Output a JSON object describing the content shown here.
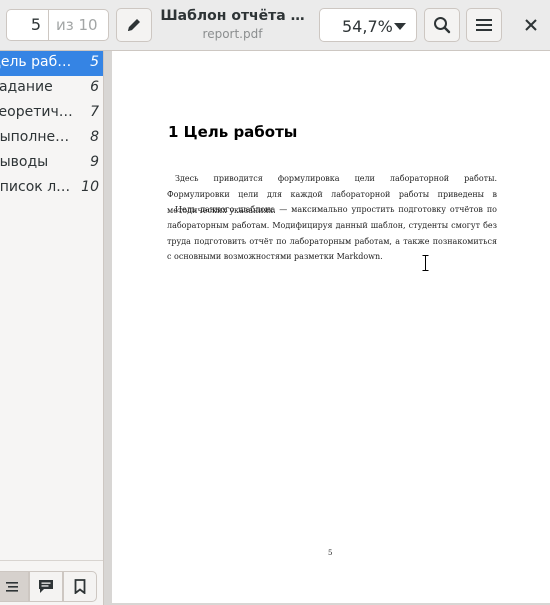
{
  "header": {
    "page_current": "5",
    "page_total": "из 10",
    "title": "Шаблон отчёта …",
    "subtitle": "report.pdf",
    "zoom": "54,7%"
  },
  "sidebar": {
    "items": [
      {
        "label": "Цель работы",
        "page": "5",
        "active": true
      },
      {
        "label": "Задание",
        "page": "6"
      },
      {
        "label": "Теоретическое введение",
        "page": "7"
      },
      {
        "label": "Выполнение лабораторной работы",
        "page": "8"
      },
      {
        "label": "Выводы",
        "page": "9"
      },
      {
        "label": "Список литературы",
        "page": "10"
      }
    ]
  },
  "document": {
    "heading": "1  Цель работы",
    "paragraphs": [
      "Здесь приводится формулировка цели лабораторной работы. Формулировки цели для каждой лабораторной работы приведены в методических указаниях.",
      "Цель данного шаблона — максимально упростить подготовку отчётов по лабораторным работам. Модифицируя данный шаблон, студенты смогут без труда подготовить отчёт по лабораторным работам, а также познакомиться с основными возможностями разметки Markdown."
    ],
    "page_number": "5"
  },
  "icons": {
    "edit": "pencil-icon",
    "search": "search-icon",
    "menu": "hamburger-menu-icon",
    "close": "close-icon",
    "outline": "outline-icon",
    "annotations": "annotations-icon",
    "bookmarks": "bookmark-icon"
  },
  "colors": {
    "accent": "#3584e4",
    "header_bg": "#ebebeb",
    "doc_bg": "#d8d6d4"
  }
}
